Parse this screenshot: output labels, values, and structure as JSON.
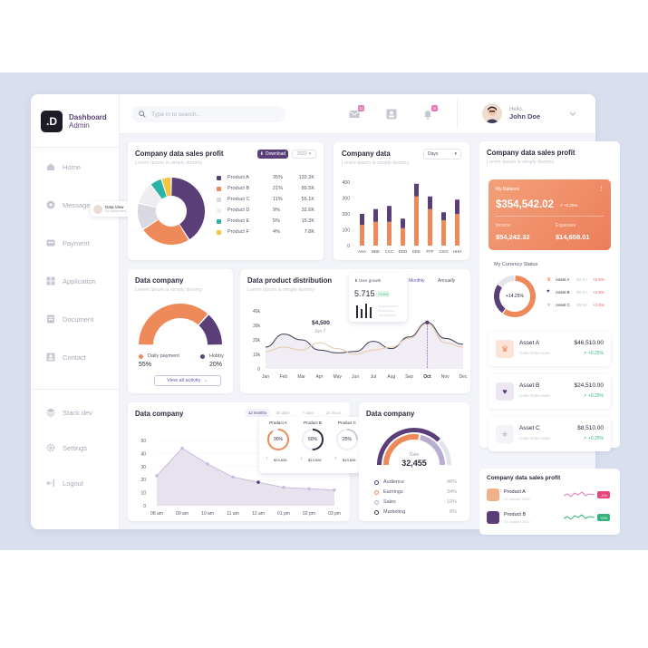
{
  "brand": {
    "logo": ".D",
    "title": "Dashboard",
    "subtitle": "Admin"
  },
  "nav": {
    "items": [
      {
        "label": "Home",
        "icon": "home-icon"
      },
      {
        "label": "Message",
        "icon": "message-icon"
      },
      {
        "label": "Payment",
        "icon": "payment-icon"
      },
      {
        "label": "Application",
        "icon": "application-icon"
      },
      {
        "label": "Document",
        "icon": "document-icon"
      },
      {
        "label": "Contact",
        "icon": "contact-icon"
      }
    ],
    "bottom": [
      {
        "label": "Stack dev",
        "icon": "stack-icon"
      },
      {
        "label": "Settings",
        "icon": "gear-icon"
      },
      {
        "label": "Logout",
        "icon": "logout-icon"
      }
    ]
  },
  "tooltip": {
    "title": "Data View",
    "sub": "Go Dashboard"
  },
  "topbar": {
    "search_placeholder": "Type in to search...",
    "mail_badge": "11",
    "bell_badge": "3",
    "hello": "Hello,",
    "user_name": "John Doe"
  },
  "colors": {
    "purple": "#5a3e78",
    "orange": "#ee8a5a",
    "light_orange": "#f3b18a",
    "gray": "#d7d8e0",
    "teal": "#2bb3a7",
    "yellow": "#f5c542",
    "green": "#34b57b"
  },
  "sales_profit": {
    "title": "Company data sales profit",
    "subtitle": "Lorem Ipsum is simply dummy",
    "download_label": "Download",
    "period_label": "2022",
    "products": [
      {
        "name": "Product A",
        "percent": "35%",
        "value": "132.3K"
      },
      {
        "name": "Product B",
        "percent": "21%",
        "value": "89.5K"
      },
      {
        "name": "Product C",
        "percent": "11%",
        "value": "55.1K"
      },
      {
        "name": "Product D",
        "percent": "9%",
        "value": "32.6K"
      },
      {
        "name": "Product E",
        "percent": "5%",
        "value": "15.3K"
      },
      {
        "name": "Product F",
        "percent": "4%",
        "value": "7.8K"
      }
    ]
  },
  "company_data_bar": {
    "title": "Company data",
    "subtitle": "Lorem Ipsum is simply dummy",
    "period": "Days"
  },
  "data_company_gauge": {
    "title": "Data company",
    "subtitle": "Lorem Ipsum is simply dummy",
    "legend": [
      {
        "label": "Daily payment",
        "value": "55%"
      },
      {
        "label": "Hobby",
        "value": "20%"
      }
    ],
    "view_all": "View all activity"
  },
  "distribution": {
    "title": "Data product distribution",
    "subtitle": "Lorem Ipsum is simply dummy",
    "tabs": [
      "Monthly",
      "Annually"
    ],
    "callout": {
      "value": "$4,500",
      "date": "Jun 7"
    },
    "popup": {
      "title": "User growth",
      "value": "5.715",
      "badge": "+3.5%"
    }
  },
  "data_company_line": {
    "title": "Data company",
    "tabs": [
      "12 months",
      "30 days",
      "7 days",
      "24 hours"
    ],
    "products": [
      {
        "name": "Product A",
        "percent": "90%",
        "value": "$13,526"
      },
      {
        "name": "Product B",
        "percent": "50%",
        "value": "$13,526"
      },
      {
        "name": "Product C",
        "percent": "25%",
        "value": "$13,526"
      }
    ]
  },
  "data_company_date": {
    "title": "Data company",
    "center_label": "Date",
    "center_value": "32,455",
    "legend": [
      {
        "label": "Audience",
        "value": "46%"
      },
      {
        "label": "Earnings",
        "value": "34%"
      },
      {
        "label": "Sales",
        "value": "10%"
      },
      {
        "label": "Marketing",
        "value": "8%"
      }
    ]
  },
  "right_panel": {
    "title": "Company data sales profit",
    "subtitle": "Lorem Ipsum is simply dummy",
    "balance": {
      "label": "My Balance",
      "value": "$354,542.02",
      "change": "+0.25%",
      "income_label": "Income",
      "income_value": "$54,242.32",
      "expenses_label": "Expenses",
      "expenses_value": "$14,658.01"
    },
    "currency_title": "My Currency Status",
    "currency_center": "+14.25%",
    "currency_rows": [
      {
        "name": "Asset A",
        "v1": "-$5.52",
        "v2": "+2.5%"
      },
      {
        "name": "Asset B",
        "v1": "-$5.52",
        "v2": "+2.6%"
      },
      {
        "name": "Asset C",
        "v1": "-$5.52",
        "v2": "+2.6%"
      }
    ],
    "assets": [
      {
        "name": "Asset A",
        "sub": "Code Data Asset",
        "value": "$46,510.00",
        "change": "+0.25%"
      },
      {
        "name": "Asset B",
        "sub": "Code Data Asset",
        "value": "$24,510.00",
        "change": "+0.25%"
      },
      {
        "name": "Asset C",
        "sub": "Code Data Asset",
        "value": "$8,510.00",
        "change": "+0.25%"
      }
    ]
  },
  "bottom_right": {
    "title": "Company data sales profit",
    "items": [
      {
        "name": "Product A",
        "date": "21 Januari 2022",
        "badge": "-2%"
      },
      {
        "name": "Product B",
        "date": "21 Januari 2022",
        "badge": "+2%"
      }
    ]
  },
  "chart_data": [
    {
      "type": "pie",
      "title": "Company data sales profit",
      "labels": [
        "Product A",
        "Product B",
        "Product C",
        "Product D",
        "Product E",
        "Product F"
      ],
      "values": [
        35,
        21,
        11,
        9,
        5,
        4
      ]
    },
    {
      "type": "bar",
      "title": "Company data",
      "categories": [
        "ASA",
        "BBE",
        "CCC",
        "DDD",
        "EEE",
        "FFF",
        "GGG",
        "HHH"
      ],
      "series": [
        {
          "values": [
            130,
            150,
            150,
            110,
            310,
            230,
            160,
            200
          ]
        },
        {
          "values": [
            70,
            80,
            100,
            60,
            80,
            80,
            50,
            90
          ]
        }
      ],
      "ylim": [
        0,
        400
      ],
      "yticks": [
        0,
        100,
        200,
        300,
        400
      ]
    },
    {
      "type": "pie",
      "title": "Data company",
      "labels": [
        "Daily payment",
        "Hobby"
      ],
      "values": [
        55,
        20
      ]
    },
    {
      "type": "line",
      "title": "Data product distribution",
      "x": [
        "Jan",
        "Feb",
        "Mar",
        "Apr",
        "May",
        "Jun",
        "Jul",
        "Aug",
        "Sep",
        "Oct",
        "Nov",
        "Dec"
      ],
      "series": [
        {
          "values": [
            15000,
            24000,
            20000,
            13000,
            11000,
            12000,
            19000,
            14000,
            22000,
            32000,
            21000,
            17000
          ]
        },
        {
          "values": [
            12000,
            15000,
            13000,
            18000,
            14000,
            10000,
            13000,
            15000,
            21000,
            31000,
            18000,
            15000
          ]
        }
      ],
      "ylim": [
        0,
        40000
      ],
      "yticks": [
        "0",
        "10k",
        "20k",
        "30k",
        "40k"
      ]
    },
    {
      "type": "area",
      "title": "Data company",
      "x": [
        "08 am",
        "09 am",
        "10 am",
        "11 am",
        "12 am",
        "01 pm",
        "02 pm",
        "03 pm"
      ],
      "values": [
        23,
        44,
        32,
        22,
        18,
        14,
        13,
        12
      ],
      "ylim": [
        0,
        50
      ],
      "yticks": [
        0,
        10,
        20,
        30,
        40,
        50
      ]
    },
    {
      "type": "pie",
      "title": "Data company",
      "labels": [
        "Audience",
        "Earnings",
        "Sales",
        "Marketing"
      ],
      "values": [
        46,
        34,
        10,
        8
      ]
    },
    {
      "type": "pie",
      "title": "My Currency Status",
      "labels": [
        "Asset A",
        "Asset B",
        "Asset C"
      ],
      "values": [
        60,
        25,
        15
      ]
    }
  ]
}
